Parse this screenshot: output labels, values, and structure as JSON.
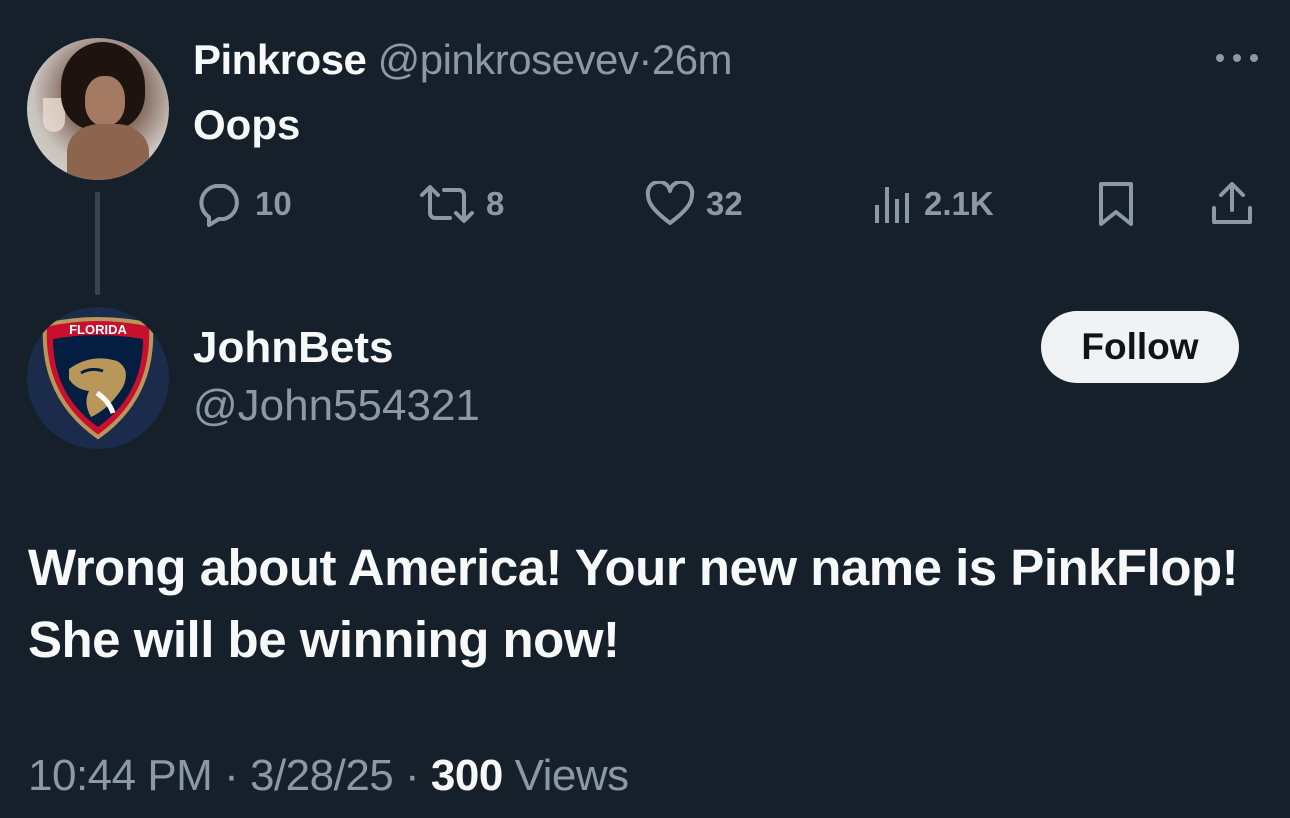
{
  "parent_tweet": {
    "author_name": "Pinkrose",
    "author_handle": "@pinkrosevev",
    "separator": "·",
    "time_ago": "26m",
    "text": "Oops",
    "avatar_icon": "profile-photo",
    "more_icon": "more-dots-icon",
    "actions": {
      "reply_count": "10",
      "retweet_count": "8",
      "like_count": "32",
      "views_count": "2.1K"
    }
  },
  "reply_tweet": {
    "author_name": "JohnBets",
    "author_handle": "@John554321",
    "avatar_icon": "florida-panthers-logo",
    "avatar_text": "FLORIDA",
    "follow_label": "Follow",
    "text": "Wrong about America! Your new name is PinkFlop! She will be winning now!",
    "time": "10:44 PM",
    "separator": "·",
    "date": "3/28/25",
    "views_count": "300",
    "views_label": "Views"
  },
  "colors": {
    "background": "#15202b",
    "primary_text": "#f7f9f9",
    "secondary_text": "#8b98a5",
    "follow_button_bg": "#eff3f4",
    "follow_button_text": "#0f1419",
    "thread_line": "#38444d"
  }
}
